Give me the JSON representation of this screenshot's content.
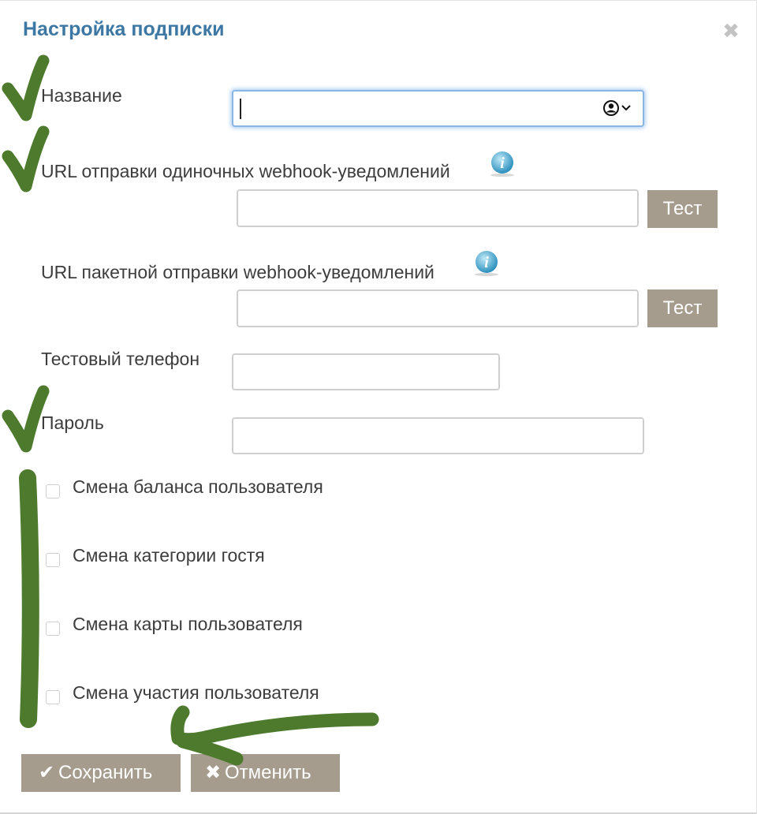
{
  "dialog": {
    "title": "Настройка подписки",
    "close_glyph": "✖"
  },
  "form": {
    "name": {
      "label": "Название",
      "value": ""
    },
    "single_url": {
      "label": "URL отправки одиночных webhook-уведомлений",
      "value": "",
      "test_label": "Тест",
      "info_icon": "info-icon"
    },
    "batch_url": {
      "label": "URL пакетной отправки webhook-уведомлений",
      "value": "",
      "test_label": "Тест",
      "info_icon": "info-icon"
    },
    "phone": {
      "label": "Тестовый телефон",
      "value": ""
    },
    "password": {
      "label": "Пароль",
      "value": ""
    }
  },
  "events": [
    {
      "label": "Смена баланса пользователя",
      "checked": false
    },
    {
      "label": "Смена категории гостя",
      "checked": false
    },
    {
      "label": "Смена карты пользователя",
      "checked": false
    },
    {
      "label": "Смена участия пользователя",
      "checked": false
    }
  ],
  "footer": {
    "save_label": "Сохранить",
    "save_icon": "✔",
    "cancel_label": "Отменить",
    "cancel_icon": "✖"
  },
  "colors": {
    "title": "#3d78a4",
    "button_bg": "#a59c8d",
    "annotation_green": "#4d7a2c"
  }
}
